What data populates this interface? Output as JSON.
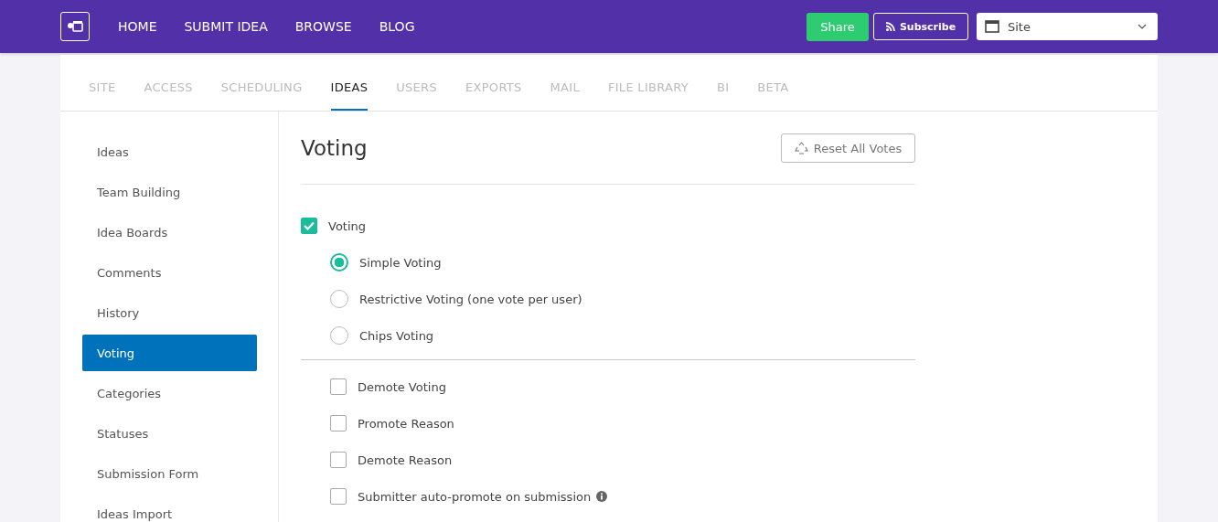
{
  "nav": {
    "links": [
      "HOME",
      "SUBMIT IDEA",
      "BROWSE",
      "BLOG"
    ],
    "share": "Share",
    "subscribe": "Subscribe",
    "site_select": {
      "value": "Site"
    }
  },
  "tabs": [
    {
      "label": "SITE",
      "selected": false
    },
    {
      "label": "ACCESS",
      "selected": false
    },
    {
      "label": "SCHEDULING",
      "selected": false
    },
    {
      "label": "IDEAS",
      "selected": true
    },
    {
      "label": "USERS",
      "selected": false
    },
    {
      "label": "EXPORTS",
      "selected": false
    },
    {
      "label": "MAIL",
      "selected": false
    },
    {
      "label": "FILE LIBRARY",
      "selected": false
    },
    {
      "label": "BI",
      "selected": false
    },
    {
      "label": "BETA",
      "selected": false
    }
  ],
  "sidebar": {
    "items": [
      {
        "label": "Ideas",
        "selected": false
      },
      {
        "label": "Team Building",
        "selected": false
      },
      {
        "label": "Idea Boards",
        "selected": false
      },
      {
        "label": "Comments",
        "selected": false
      },
      {
        "label": "History",
        "selected": false
      },
      {
        "label": "Voting",
        "selected": true
      },
      {
        "label": "Categories",
        "selected": false
      },
      {
        "label": "Statuses",
        "selected": false
      },
      {
        "label": "Submission Form",
        "selected": false
      },
      {
        "label": "Ideas Import",
        "selected": false
      }
    ]
  },
  "content": {
    "title": "Voting",
    "reset_button": "Reset All Votes",
    "voting": {
      "label": "Voting",
      "checked": true
    },
    "modes": [
      {
        "label": "Simple Voting",
        "selected": true
      },
      {
        "label": "Restrictive Voting (one vote per user)",
        "selected": false
      },
      {
        "label": "Chips Voting",
        "selected": false
      }
    ],
    "options": [
      {
        "label": "Demote Voting",
        "checked": false,
        "info": false
      },
      {
        "label": "Promote Reason",
        "checked": false,
        "info": false
      },
      {
        "label": "Demote Reason",
        "checked": false,
        "info": false
      },
      {
        "label": "Submitter auto-promote on submission",
        "checked": false,
        "info": true
      }
    ]
  }
}
